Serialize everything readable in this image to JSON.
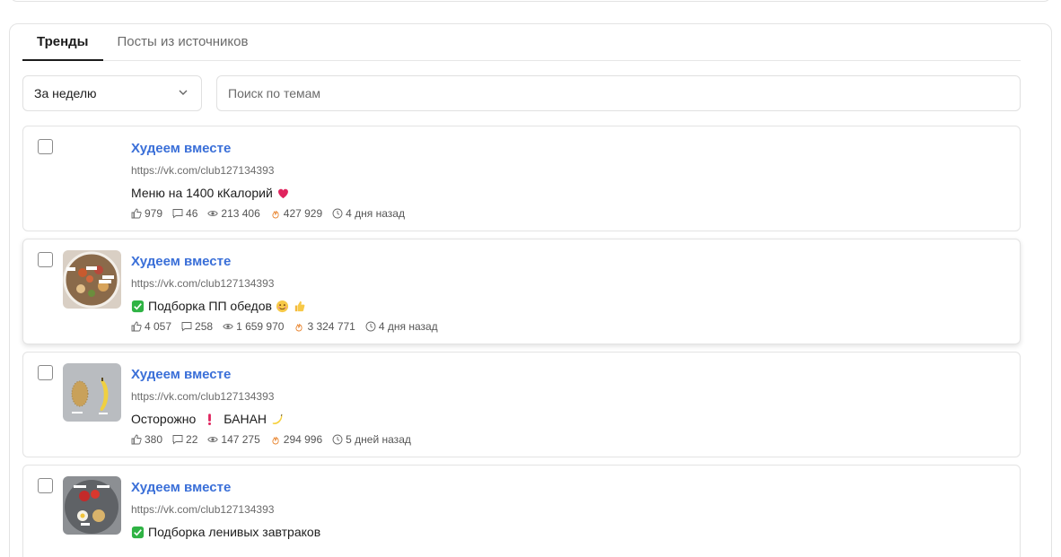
{
  "tabs": [
    {
      "label": "Тренды",
      "active": true
    },
    {
      "label": "Посты из источников",
      "active": false
    }
  ],
  "filters": {
    "period_label": "За неделю",
    "search_placeholder": "Поиск по темам"
  },
  "posts": [
    {
      "source": "Худеем вместе",
      "url": "https://vk.com/club127134393",
      "text": "Меню на 1400 кКалорий",
      "emoji_after": "heart",
      "likes": "979",
      "comments": "46",
      "views": "213 406",
      "score": "427 929",
      "time": "4 дня назад",
      "has_thumb": false
    },
    {
      "source": "Худеем вместе",
      "url": "https://vk.com/club127134393",
      "text": "Подборка ПП обедов",
      "emoji_before": "check",
      "emoji_after": "smile-thumb",
      "likes": "4 057",
      "comments": "258",
      "views": "1 659 970",
      "score": "3 324 771",
      "time": "4 дня назад",
      "has_thumb": true
    },
    {
      "source": "Худеем вместе",
      "url": "https://vk.com/club127134393",
      "text": "Осторожно",
      "text2": "БАНАН",
      "emoji_mid": "exclamation",
      "emoji_after": "banana",
      "likes": "380",
      "comments": "22",
      "views": "147 275",
      "score": "294 996",
      "time": "5 дней назад",
      "has_thumb": true
    },
    {
      "source": "Худеем вместе",
      "url": "https://vk.com/club127134393",
      "text": "Подборка ленивых завтраков",
      "emoji_before": "check",
      "has_thumb": true
    }
  ],
  "colors": {
    "link": "#3a6fd8",
    "fire": "#e8822a",
    "check_green": "#2fb344",
    "heart_red": "#e0245e"
  }
}
